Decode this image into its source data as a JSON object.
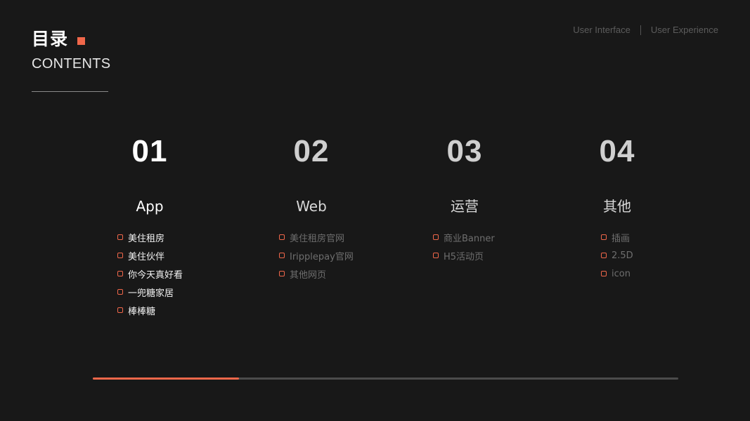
{
  "header": {
    "title_cn": "目录",
    "title_en": "CONTENTS",
    "accent_color": "#f0674a"
  },
  "top_nav": {
    "left": "User Interface",
    "right": "User Experience"
  },
  "sections": [
    {
      "number": "01",
      "heading": "App",
      "items": [
        "美住租房",
        "美住伙伴",
        "你今天真好看",
        "一兜糖家居",
        "棒棒糖"
      ]
    },
    {
      "number": "02",
      "heading": "Web",
      "items": [
        "美住租房官网",
        "Iripplepay官网",
        "其他网页"
      ]
    },
    {
      "number": "03",
      "heading": "运营",
      "items": [
        "商业Banner",
        "H5活动页"
      ]
    },
    {
      "number": "04",
      "heading": "其他",
      "items": [
        "插画",
        "2.5D",
        "icon"
      ]
    }
  ],
  "progress": {
    "value": 0.25,
    "active_section": 1
  }
}
